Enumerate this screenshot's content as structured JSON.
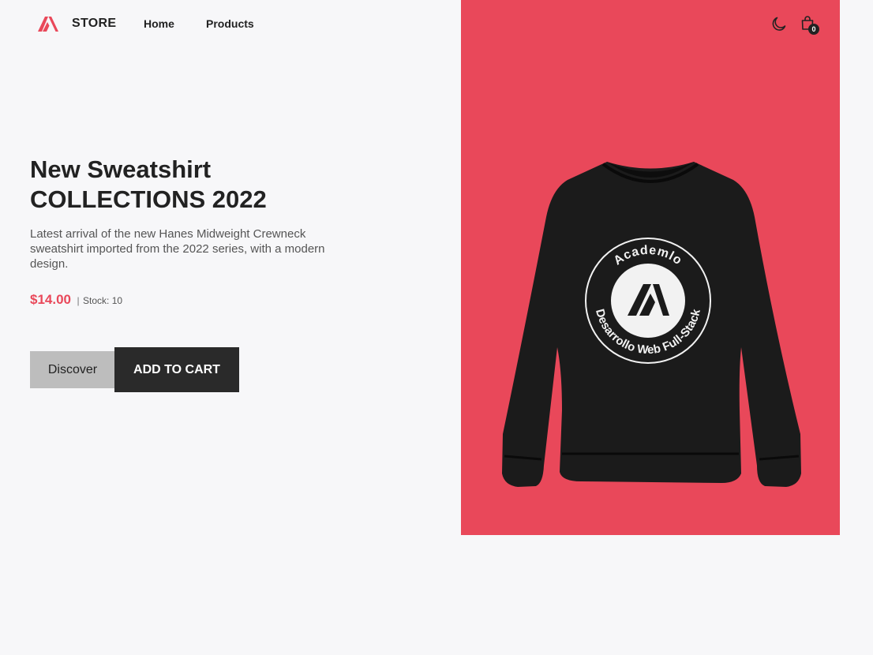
{
  "header": {
    "brand": "STORE",
    "logo_icon": "academlo-logo-icon",
    "nav": [
      {
        "label": "Home"
      },
      {
        "label": "Products"
      }
    ],
    "theme_icon": "moon-icon",
    "cart_icon": "shopping-bag-icon",
    "cart_count": "0"
  },
  "hero": {
    "title_line1": "New Sweatshirt",
    "title_line2": "COLLECTIONS 2022",
    "description": "Latest arrival of the new Hanes Midweight Crewneck sweatshirt imported from the 2022 series, with a modern design.",
    "price": "$14.00",
    "separator": "|",
    "stock_text": "Stock: 10",
    "discover_label": "Discover",
    "add_to_cart_label": "ADD TO CART",
    "image": {
      "top_text": "Academlo",
      "bottom_text": "Desarrollo Web Full-Stack"
    }
  },
  "colors": {
    "accent": "#e9485a",
    "dark": "#2a2a2a",
    "background": "#f7f7f9",
    "discover_bg": "#bdbdbd"
  }
}
